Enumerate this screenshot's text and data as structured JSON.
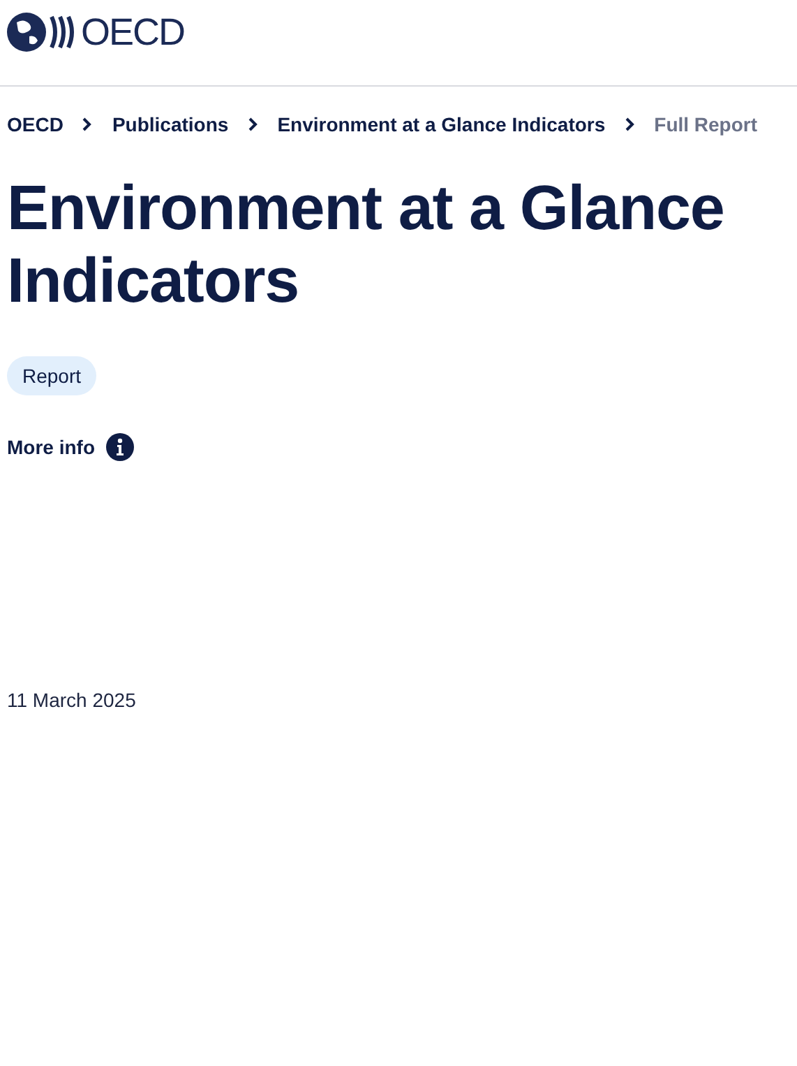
{
  "header": {
    "logo_text": "OECD"
  },
  "breadcrumbs": [
    {
      "label": "OECD",
      "current": false
    },
    {
      "label": "Publications",
      "current": false
    },
    {
      "label": "Environment at a Glance Indicators",
      "current": false
    },
    {
      "label": "Full Report",
      "current": true
    }
  ],
  "title": "Environment at a Glance Indicators",
  "tag": "Report",
  "more_info": "More info",
  "date": "11 March 2025"
}
